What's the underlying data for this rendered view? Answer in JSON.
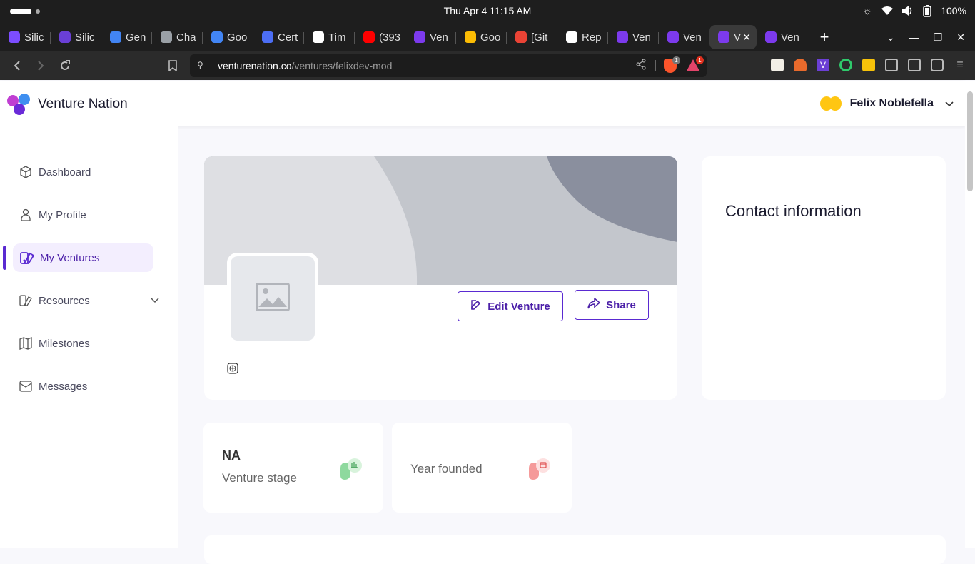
{
  "os": {
    "clock": "Thu Apr 4  11:15 AM",
    "battery": "100%"
  },
  "tabs": [
    {
      "title": "Silic",
      "color": "#7c4dff"
    },
    {
      "title": "Silic",
      "color": "#6a3fd6"
    },
    {
      "title": "Gen",
      "color": "#4285f4"
    },
    {
      "title": "Cha",
      "color": "#9aa0a6"
    },
    {
      "title": "Goo",
      "color": "#4285f4"
    },
    {
      "title": "Cert",
      "color": "#4c6ef5"
    },
    {
      "title": "Tim",
      "color": "#ffffff"
    },
    {
      "title": "(393",
      "color": "#ff0000"
    },
    {
      "title": "Ven",
      "color": "#7c3aed"
    },
    {
      "title": "Goo",
      "color": "#fbbc04"
    },
    {
      "title": "[Git",
      "color": "#ea4335"
    },
    {
      "title": "Rep",
      "color": "#ffffff"
    },
    {
      "title": "Ven",
      "color": "#7c3aed"
    },
    {
      "title": "Ven",
      "color": "#7c3aed"
    },
    {
      "title": "V",
      "color": "#7c3aed",
      "active": true
    },
    {
      "title": "Ven",
      "color": "#7c3aed"
    }
  ],
  "address": {
    "host": "venturenation.co",
    "path": "/ventures/felixdev-mod",
    "brave_badge": "1",
    "rewards_badge": "1"
  },
  "app": {
    "brand": "Venture Nation",
    "user_name": "Felix Noblefella"
  },
  "sidebar": {
    "items": [
      {
        "label": "Dashboard",
        "icon": "cube-icon"
      },
      {
        "label": "My Profile",
        "icon": "user-icon"
      },
      {
        "label": "My Ventures",
        "icon": "ventures-icon",
        "active": true
      },
      {
        "label": "Resources",
        "icon": "book-icon",
        "expandable": true
      },
      {
        "label": "Milestones",
        "icon": "map-icon"
      },
      {
        "label": "Messages",
        "icon": "mail-icon"
      }
    ]
  },
  "venture": {
    "edit_label": "Edit Venture",
    "share_label": "Share",
    "contact_title": "Contact information"
  },
  "stats": [
    {
      "value": "NA",
      "label": "Venture stage",
      "icon": "chart-icon",
      "color": "#58c36e"
    },
    {
      "value": "",
      "label": "Year founded",
      "icon": "calendar-icon",
      "color": "#f06a6a"
    }
  ],
  "colors": {
    "accent": "#5a2ad1",
    "active_bg": "#f3eefe"
  }
}
